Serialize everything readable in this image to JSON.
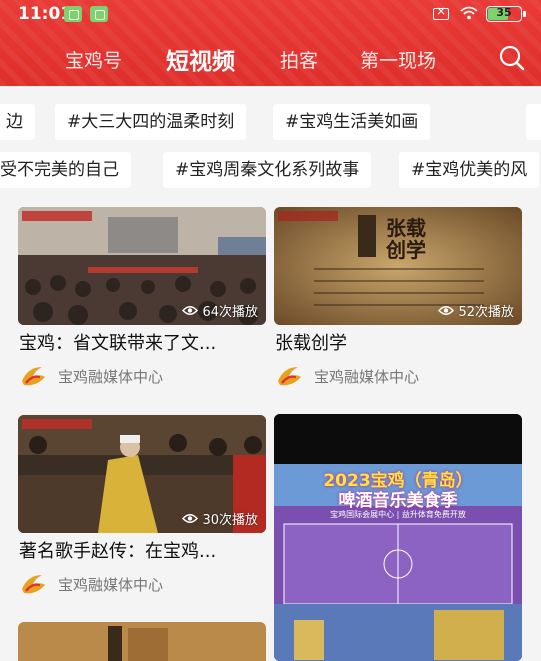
{
  "status": {
    "time": "11:01",
    "battery": "35",
    "battery_color": "#7dd36b"
  },
  "tabs": [
    {
      "label": "宝鸡号"
    },
    {
      "label": "短视频"
    },
    {
      "label": "拍客"
    },
    {
      "label": "第一现场"
    }
  ],
  "tag_rows": [
    [
      "边",
      "#大三大四的温柔时刻",
      "#宝鸡生活美如画"
    ],
    [
      "受不完美的自己",
      "#宝鸡周秦文化系列故事",
      "#宝鸡优美的风"
    ]
  ],
  "videos": [
    {
      "title": "宝鸡：省文联带来了文...",
      "plays": "64次播放",
      "author": "宝鸡融媒体中心"
    },
    {
      "title": "张载创学",
      "plays": "52次播放",
      "author": "宝鸡融媒体中心",
      "thumb_title": "张载创学"
    },
    {
      "title": "著名歌手赵传：在宝鸡...",
      "plays": "30次播放",
      "author": "宝鸡融媒体中心"
    }
  ],
  "promo": {
    "headline_1": "2023宝鸡（青岛）",
    "headline_2": "啤酒音乐美食季",
    "subline": "宝鸡国际会展中心 | 益升体育免费开放"
  },
  "colors": {
    "brand_red": "#e23532",
    "card_bg": "#ffffff"
  }
}
